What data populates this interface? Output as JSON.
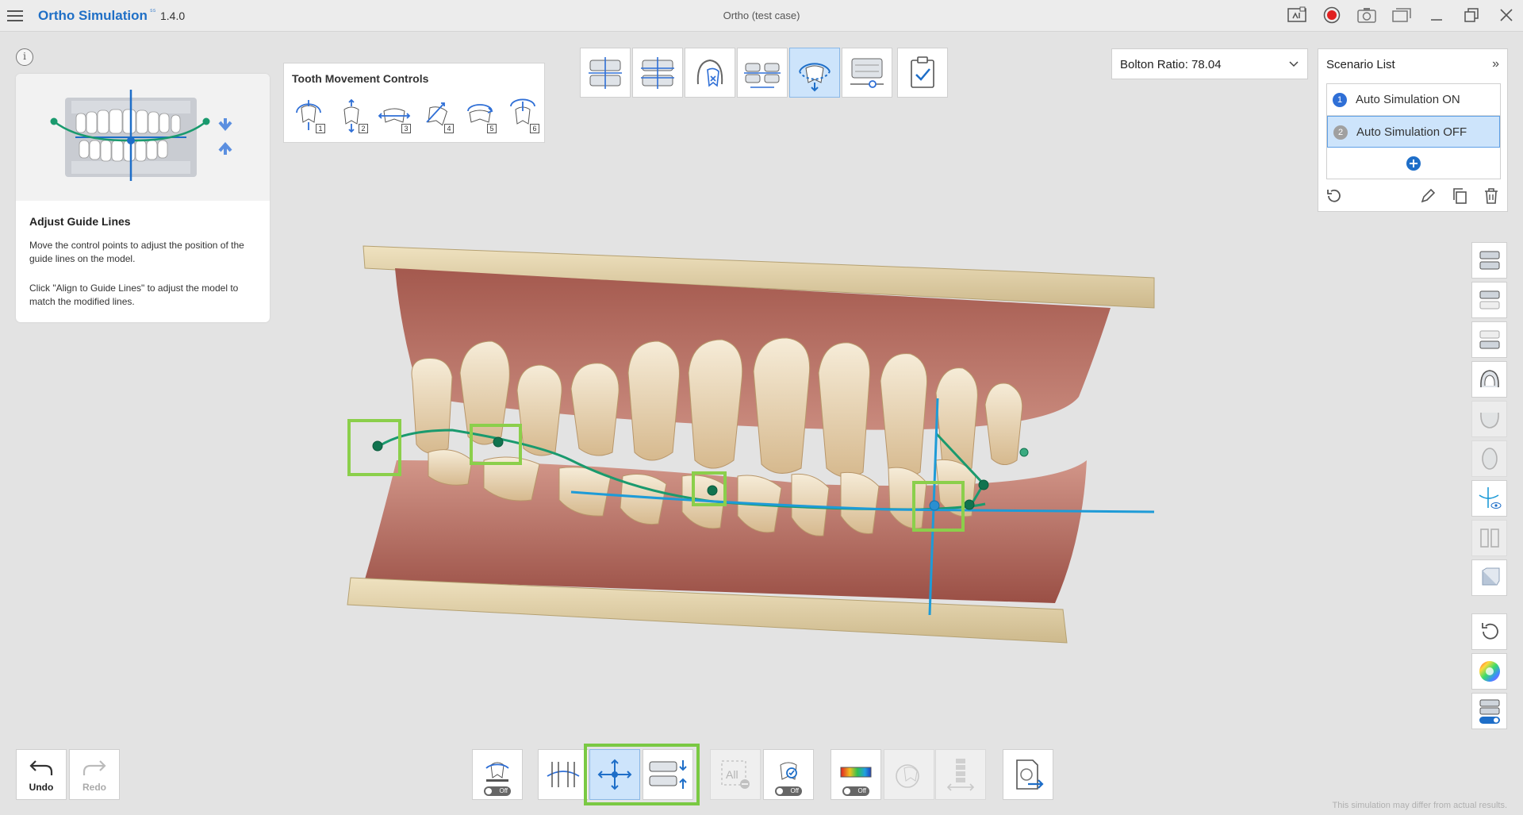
{
  "app": {
    "title": "Ortho Simulation",
    "version": "1.4.0",
    "case_title": "Ortho (test case)"
  },
  "window_icons": [
    "screen-capture-icon",
    "record-icon",
    "camera-icon",
    "gallery-icon",
    "minimize-icon",
    "restore-icon",
    "close-icon"
  ],
  "guide": {
    "info": "i",
    "title": "Adjust Guide Lines",
    "text1": "Move the control points to adjust the position of the guide lines on the model.",
    "text2": "Click \"Align to Guide Lines\" to adjust the model to match the modified lines."
  },
  "tooth_movement": {
    "title": "Tooth Movement Controls",
    "items": [
      "1",
      "2",
      "3",
      "4",
      "5",
      "6"
    ]
  },
  "top_toolbar": {
    "active_index": 4,
    "items": [
      "arch-front-view-icon",
      "arch-split-view-icon",
      "tooth-extraction-icon",
      "arch-align-icon",
      "guide-rotation-icon",
      "occlusion-slider-icon",
      "approve-checklist-icon"
    ]
  },
  "bolton": {
    "label": "Bolton Ratio: 78.04"
  },
  "scenario": {
    "title": "Scenario List",
    "items": [
      {
        "num": "1",
        "label": "Auto Simulation ON",
        "color": "#2f6fd6"
      },
      {
        "num": "2",
        "label": "Auto Simulation OFF",
        "color": "#a0a0a0"
      }
    ]
  },
  "bottom": {
    "undo": "Undo",
    "redo": "Redo",
    "off_label": "Off",
    "disclaimer": "This simulation may differ from actual results."
  },
  "colors": {
    "accent": "#1f6fc6",
    "highlight_green": "#7ac943",
    "guide_green": "#1a9a6e",
    "guide_blue": "#1e9bd7"
  }
}
